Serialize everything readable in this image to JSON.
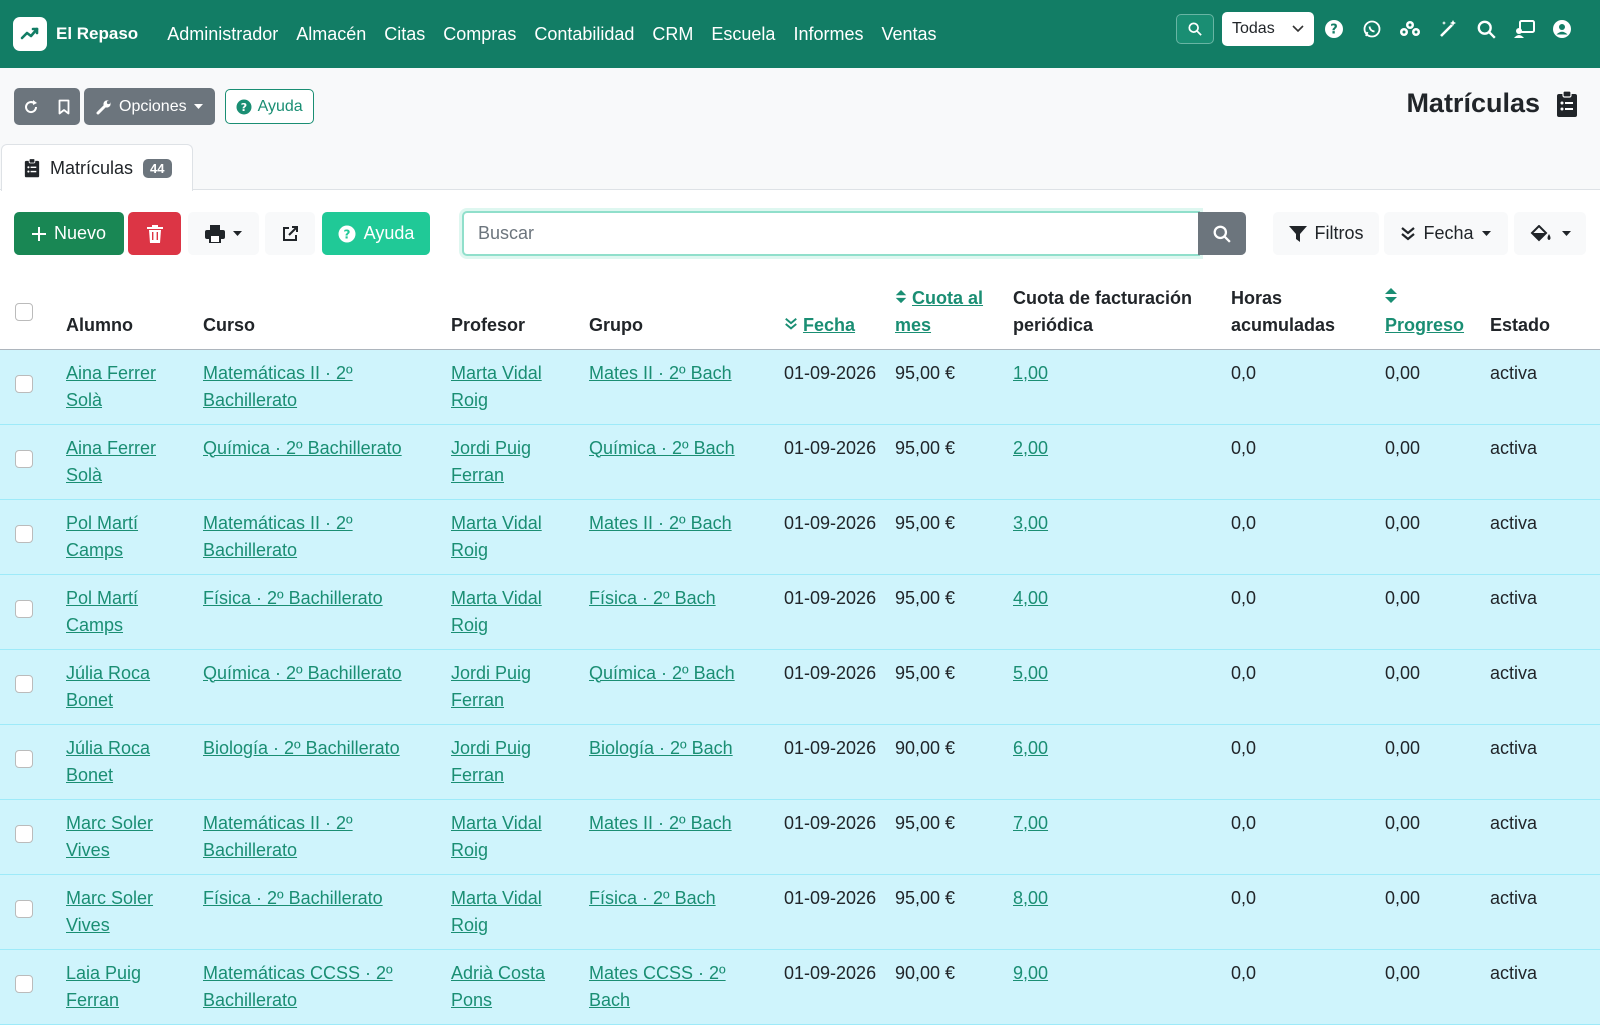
{
  "app": {
    "name": "El Repaso"
  },
  "nav": {
    "menu": [
      "Administrador",
      "Almacén",
      "Citas",
      "Compras",
      "Contabilidad",
      "CRM",
      "Escuela",
      "Informes",
      "Ventas"
    ],
    "company_select": "Todas",
    "icons": [
      "help-icon",
      "whatsapp-icon",
      "users-icon",
      "magic-icon",
      "search-icon",
      "support-icon",
      "user-icon"
    ]
  },
  "toolbar": {
    "options_label": "Opciones",
    "help_label": "Ayuda"
  },
  "page": {
    "title": "Matrículas"
  },
  "tab": {
    "label": "Matrículas",
    "count": "44"
  },
  "actions": {
    "new_label": "Nuevo",
    "help_label": "Ayuda",
    "search_placeholder": "Buscar",
    "filters_label": "Filtros",
    "date_label": "Fecha"
  },
  "colors": {
    "primary": "#127d65",
    "link": "#1a8e73",
    "row": "#cff4fc",
    "new": "#198754",
    "delete": "#dc3545",
    "help": "#20c997"
  },
  "table": {
    "headers": {
      "student": "Alumno",
      "course": "Curso",
      "teacher": "Profesor",
      "group": "Grupo",
      "date": "Fecha",
      "fee_line1": "Cuota al",
      "fee_line2": "mes",
      "billing_line1": "Cuota de facturación",
      "billing_line2": "periódica",
      "hours_line1": "Horas",
      "hours_line2": "acumuladas",
      "progress": "Progreso",
      "status": "Estado"
    },
    "rows": [
      {
        "student": "Aina Ferrer Solà",
        "course": "Matemáticas II · 2º Bachillerato",
        "teacher": "Marta Vidal Roig",
        "group": "Mates II · 2º Bach",
        "date": "01-09-2026",
        "fee": "95,00 €",
        "billing": "1,00",
        "hours": "0,0",
        "progress": "0,00",
        "status": "activa"
      },
      {
        "student": "Aina Ferrer Solà",
        "course": "Química · 2º Bachillerato",
        "teacher": "Jordi Puig Ferran",
        "group": "Química · 2º Bach",
        "date": "01-09-2026",
        "fee": "95,00 €",
        "billing": "2,00",
        "hours": "0,0",
        "progress": "0,00",
        "status": "activa"
      },
      {
        "student": "Pol Martí Camps",
        "course": "Matemáticas II · 2º Bachillerato",
        "teacher": "Marta Vidal Roig",
        "group": "Mates II · 2º Bach",
        "date": "01-09-2026",
        "fee": "95,00 €",
        "billing": "3,00",
        "hours": "0,0",
        "progress": "0,00",
        "status": "activa"
      },
      {
        "student": "Pol Martí Camps",
        "course": "Física · 2º Bachillerato",
        "teacher": "Marta Vidal Roig",
        "group": "Física · 2º Bach",
        "date": "01-09-2026",
        "fee": "95,00 €",
        "billing": "4,00",
        "hours": "0,0",
        "progress": "0,00",
        "status": "activa"
      },
      {
        "student": "Júlia Roca Bonet",
        "course": "Química · 2º Bachillerato",
        "teacher": "Jordi Puig Ferran",
        "group": "Química · 2º Bach",
        "date": "01-09-2026",
        "fee": "95,00 €",
        "billing": "5,00",
        "hours": "0,0",
        "progress": "0,00",
        "status": "activa"
      },
      {
        "student": "Júlia Roca Bonet",
        "course": "Biología · 2º Bachillerato",
        "teacher": "Jordi Puig Ferran",
        "group": "Biología · 2º Bach",
        "date": "01-09-2026",
        "fee": "90,00 €",
        "billing": "6,00",
        "hours": "0,0",
        "progress": "0,00",
        "status": "activa"
      },
      {
        "student": "Marc Soler Vives",
        "course": "Matemáticas II · 2º Bachillerato",
        "teacher": "Marta Vidal Roig",
        "group": "Mates II · 2º Bach",
        "date": "01-09-2026",
        "fee": "95,00 €",
        "billing": "7,00",
        "hours": "0,0",
        "progress": "0,00",
        "status": "activa"
      },
      {
        "student": "Marc Soler Vives",
        "course": "Física · 2º Bachillerato",
        "teacher": "Marta Vidal Roig",
        "group": "Física · 2º Bach",
        "date": "01-09-2026",
        "fee": "95,00 €",
        "billing": "8,00",
        "hours": "0,0",
        "progress": "0,00",
        "status": "activa"
      },
      {
        "student": "Laia Puig Ferran",
        "course": "Matemáticas CCSS · 2º Bachillerato",
        "teacher": "Adrià Costa Pons",
        "group": "Mates CCSS · 2º Bach",
        "date": "01-09-2026",
        "fee": "90,00 €",
        "billing": "9,00",
        "hours": "0,0",
        "progress": "0,00",
        "status": "activa"
      }
    ]
  }
}
